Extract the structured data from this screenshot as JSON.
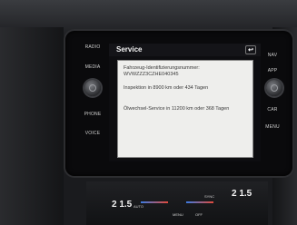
{
  "left_buttons": {
    "radio": "RADIO",
    "media": "MEDIA",
    "phone": "PHONE",
    "voice": "VOICE"
  },
  "right_buttons": {
    "nav": "NAV",
    "app": "APP",
    "car": "CAR",
    "menu": "MENU"
  },
  "screen": {
    "title": "Service",
    "back_glyph": "↩"
  },
  "dialog": {
    "vin_label": "Fahrzeug-Identifizierungsnummer:",
    "vin_value": "WVWZZZ3CZHE040345",
    "inspection": "Inspektion in 8900 km oder 434 Tagen",
    "oil_service": "Ölwechsel-Service in 11200 km oder 368 Tagen"
  },
  "climate": {
    "temp_left": "2 1.5",
    "temp_right": "2 1.5",
    "auto_label": "AUTO",
    "off_label": "OFF",
    "menu_label": "MENU",
    "sync_label": "SYNC"
  },
  "colors": {
    "slider_hot": "#e24a3b",
    "slider_cold": "#3b7be2"
  }
}
